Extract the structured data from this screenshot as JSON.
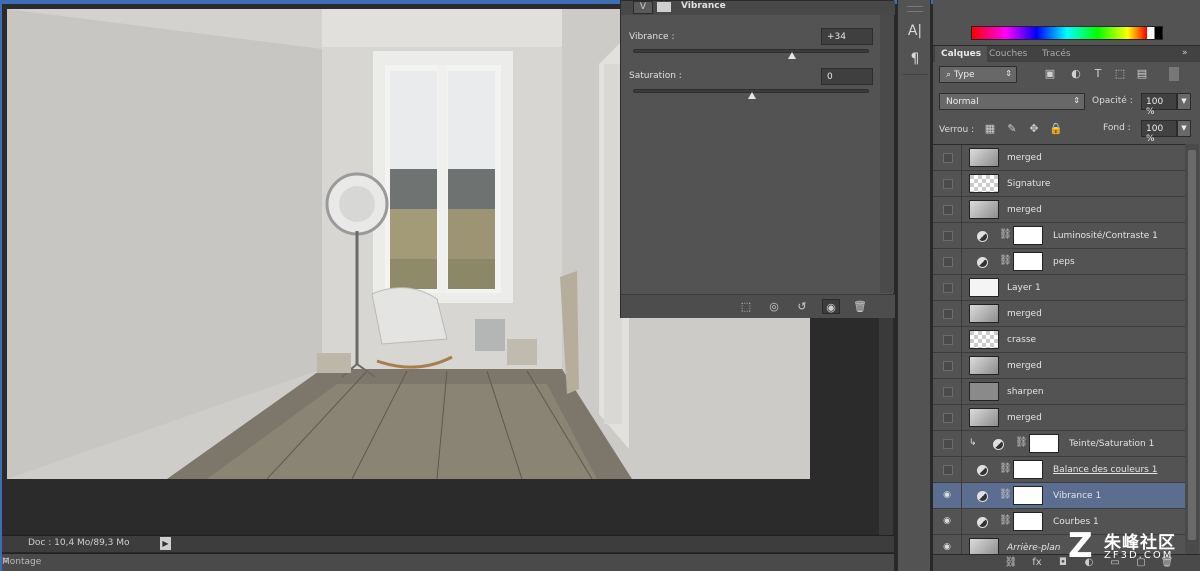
{
  "status": {
    "doc": "Doc : 10,4 Mo/89,3 Mo",
    "montage": "Montage"
  },
  "properties": {
    "title": "Vibrance",
    "vibrance": {
      "label": "Vibrance :",
      "value": "+34",
      "slider": 0.67
    },
    "saturation": {
      "label": "Saturation :",
      "value": "0",
      "slider": 0.5
    }
  },
  "toolcol": {
    "char_tool": "A|",
    "para_tool": "¶"
  },
  "layers_panel": {
    "tabs": [
      "Calques",
      "Couches",
      "Tracés"
    ],
    "filter_type": "Type",
    "blend_mode": "Normal",
    "opacity_label": "Opacité :",
    "opacity_value": "100 %",
    "lock_label": "Verrou :",
    "fill_label": "Fond :",
    "fill_value": "100 %",
    "layers": [
      {
        "name": "merged",
        "kind": "photo",
        "visible": false
      },
      {
        "name": "Signature",
        "kind": "check",
        "visible": false
      },
      {
        "name": "merged",
        "kind": "photo",
        "visible": false
      },
      {
        "name": "Luminosité/Contraste 1",
        "kind": "adjustment",
        "visible": false
      },
      {
        "name": "peps",
        "kind": "adjustment",
        "visible": false
      },
      {
        "name": "Layer 1",
        "kind": "white",
        "visible": false
      },
      {
        "name": "merged",
        "kind": "photo",
        "visible": false
      },
      {
        "name": "crasse",
        "kind": "check",
        "visible": false
      },
      {
        "name": "merged",
        "kind": "photo",
        "visible": false
      },
      {
        "name": "sharpen",
        "kind": "gray",
        "visible": false
      },
      {
        "name": "merged",
        "kind": "photo",
        "visible": false
      },
      {
        "name": "Teinte/Saturation 1",
        "kind": "adjustment-clip",
        "visible": false
      },
      {
        "name": "Balance des couleurs 1",
        "kind": "adjustment",
        "visible": false
      },
      {
        "name": "Vibrance 1",
        "kind": "adjustment",
        "visible": true,
        "selected": true
      },
      {
        "name": "Courbes 1",
        "kind": "adjustment",
        "visible": true
      },
      {
        "name": "Arrière-plan",
        "kind": "photo",
        "visible": true
      }
    ]
  },
  "watermark": {
    "logo": "Z",
    "brand": "朱峰社区",
    "url": "ZF3D.COM"
  },
  "colors": {
    "selected_layer": "#5b6e8f",
    "panel_bg": "#535353",
    "accent_frame": "#3d6db5"
  }
}
